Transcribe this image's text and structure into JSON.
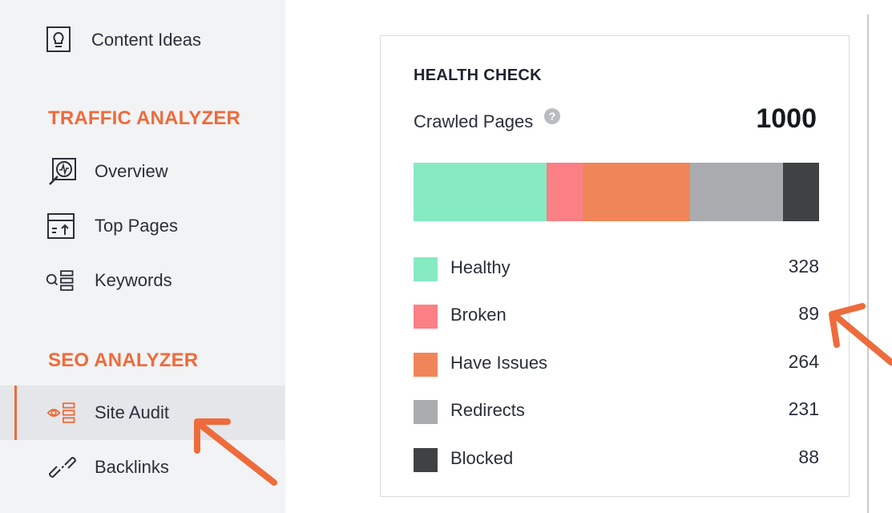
{
  "sidebar": {
    "items_top": [
      {
        "label": "Content Ideas",
        "icon": "lightbulb-icon"
      }
    ],
    "sections": [
      {
        "title": "TRAFFIC ANALYZER",
        "items": [
          {
            "label": "Overview",
            "icon": "overview-icon"
          },
          {
            "label": "Top Pages",
            "icon": "top-pages-icon"
          },
          {
            "label": "Keywords",
            "icon": "keywords-icon"
          }
        ]
      },
      {
        "title": "SEO ANALYZER",
        "items": [
          {
            "label": "Site Audit",
            "icon": "site-audit-icon",
            "active": true
          },
          {
            "label": "Backlinks",
            "icon": "link-icon"
          }
        ]
      }
    ]
  },
  "health_check": {
    "title": "HEALTH CHECK",
    "crawled_label": "Crawled Pages",
    "crawled_value": "1000",
    "categories": [
      {
        "name": "Healthy",
        "value": "328",
        "color": "#86eac3"
      },
      {
        "name": "Broken",
        "value": "89",
        "color": "#fa8086"
      },
      {
        "name": "Have Issues",
        "value": "264",
        "color": "#f1855a"
      },
      {
        "name": "Redirects",
        "value": "231",
        "color": "#a9abaf"
      },
      {
        "name": "Blocked",
        "value": "88",
        "color": "#404143"
      }
    ]
  },
  "annotations": {
    "arrow_color": "#ee6b3b"
  }
}
